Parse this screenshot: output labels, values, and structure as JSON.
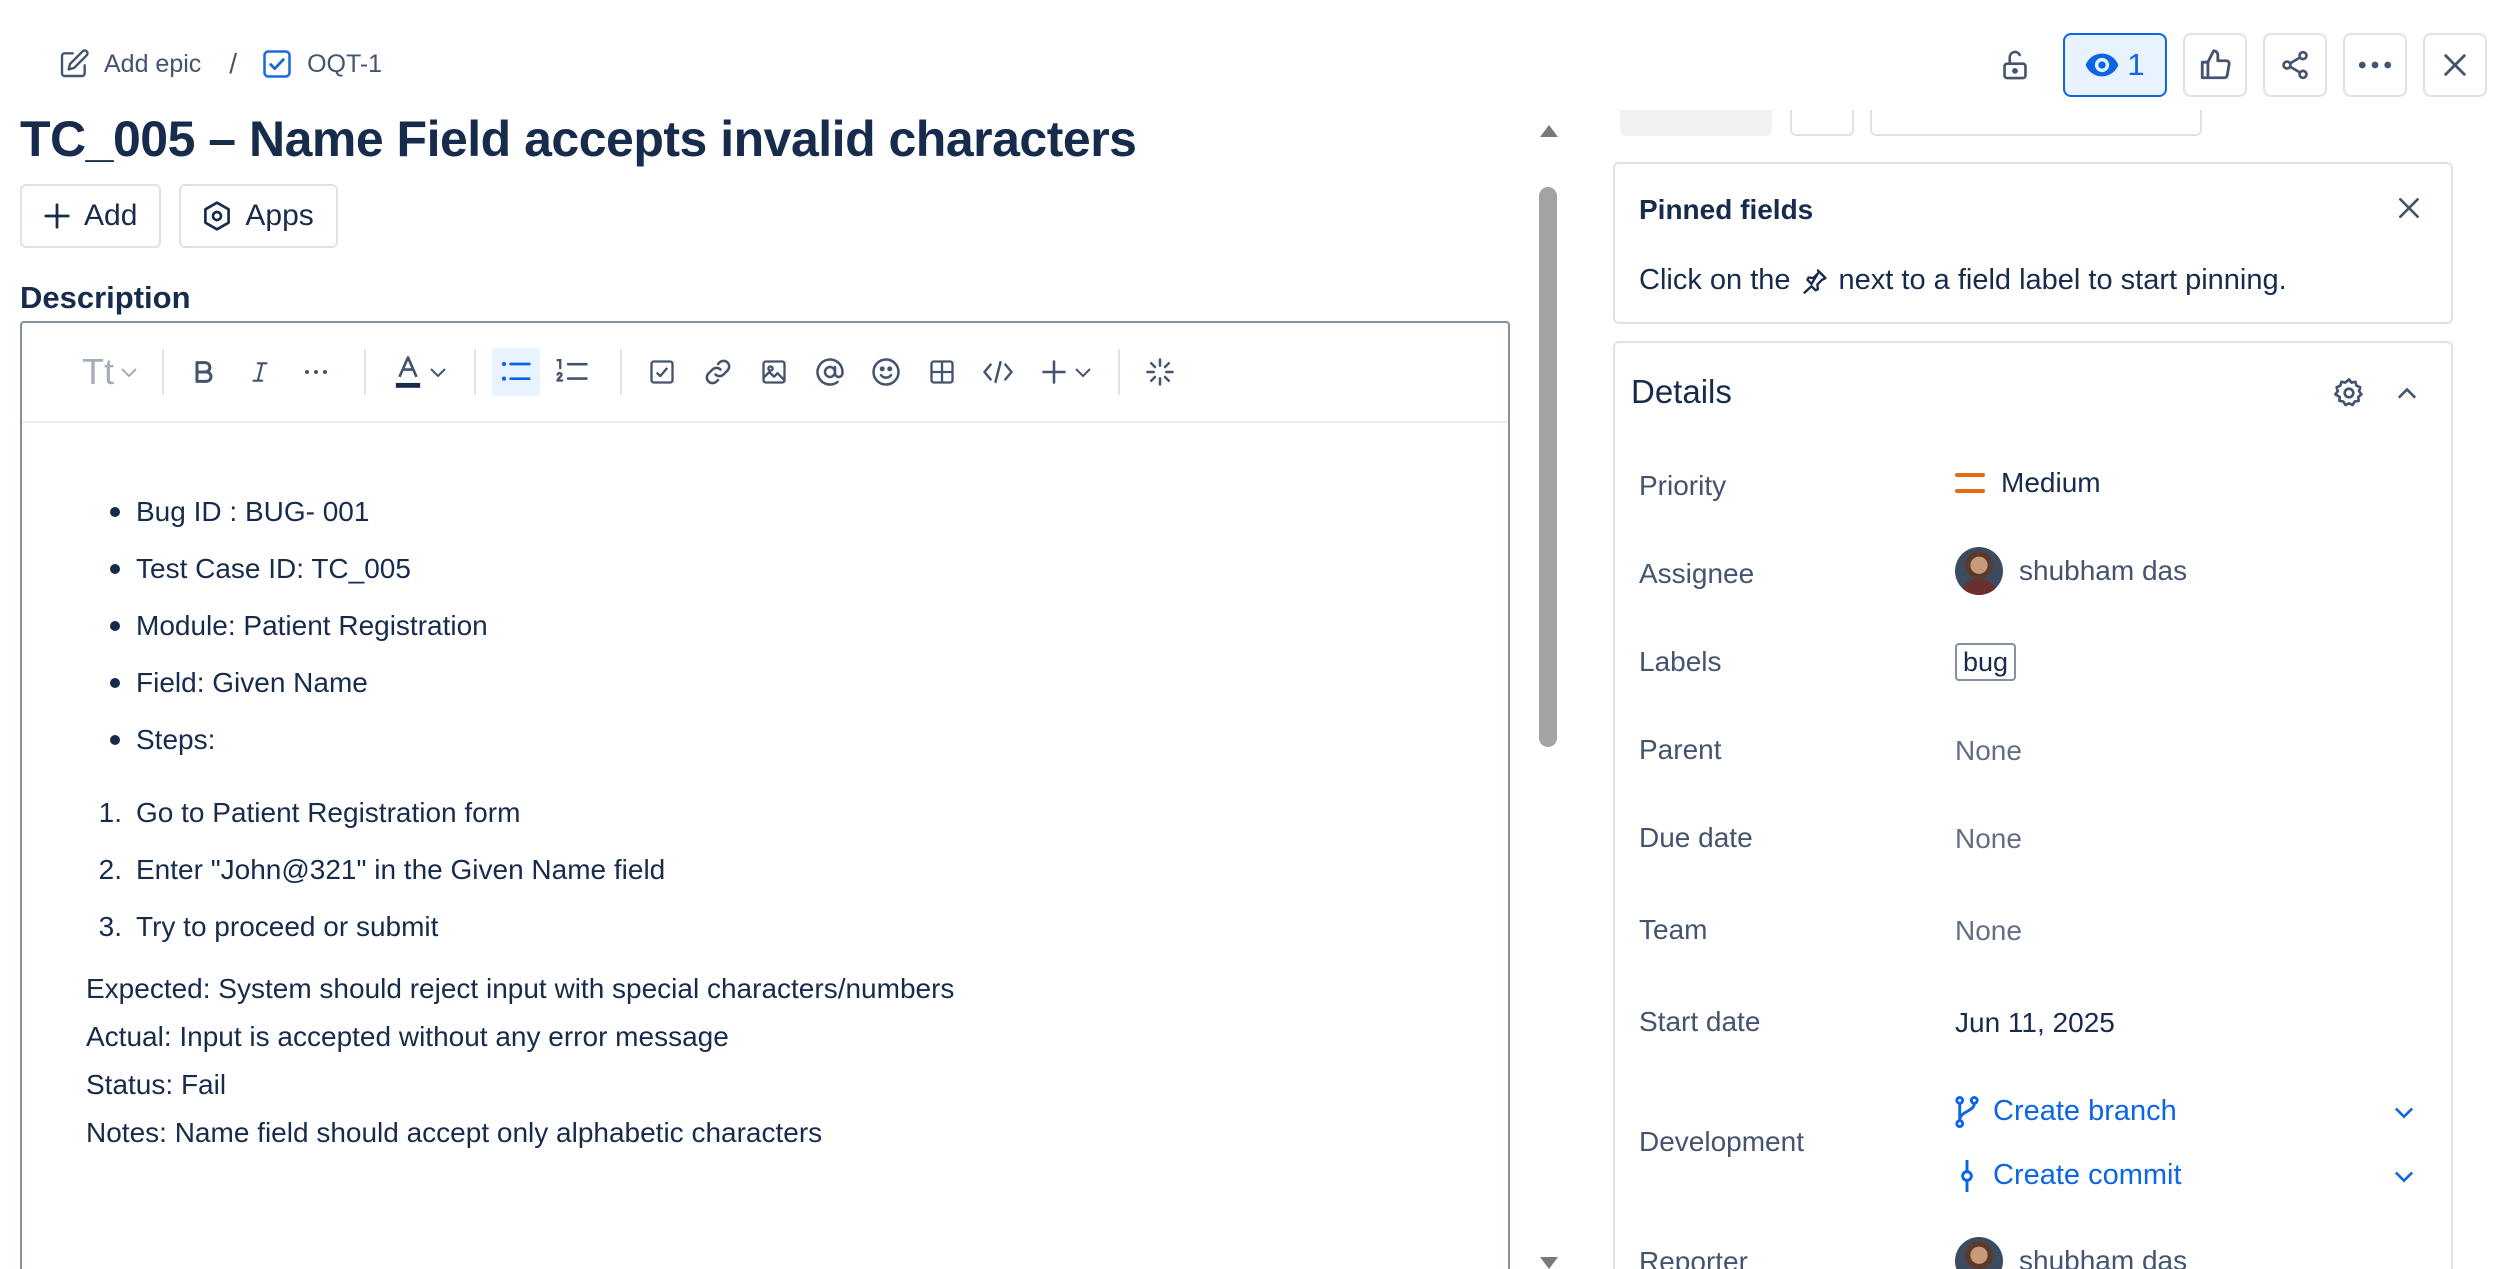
{
  "breadcrumb": {
    "epic_label": "Add epic",
    "separator": "/",
    "issue_key": "OQT-1"
  },
  "header_actions": {
    "watch_count": "1"
  },
  "issue": {
    "title": "TC_005 – Name Field accepts invalid characters",
    "add_label": "Add",
    "apps_label": "Apps",
    "description_label": "Description"
  },
  "editor": {
    "text_style_placeholder": "Tt",
    "bullets": [
      "Bug ID : BUG- 001",
      "Test Case ID: TC_005",
      "Module: Patient Registration",
      "Field: Given Name",
      "Steps:"
    ],
    "steps": [
      {
        "num": "1.",
        "text": "Go to Patient Registration form"
      },
      {
        "num": "2.",
        "text": "Enter \"John@321\" in the Given Name field"
      },
      {
        "num": "3.",
        "text": "Try to proceed or submit"
      }
    ],
    "lines": [
      "Expected: System should reject input with special characters/numbers",
      "Actual: Input is accepted without any error message",
      "Status: Fail",
      "Notes: Name field should accept only alphabetic characters"
    ]
  },
  "pinned": {
    "title": "Pinned fields",
    "hint_before": "Click on the",
    "hint_after": "next to a field label to start pinning."
  },
  "details": {
    "title": "Details",
    "priority_label": "Priority",
    "priority_value": "Medium",
    "priority_color": "#e56910",
    "assignee_label": "Assignee",
    "assignee_value": "shubham das",
    "labels_label": "Labels",
    "labels_value": "bug",
    "parent_label": "Parent",
    "parent_value": "None",
    "due_label": "Due date",
    "due_value": "None",
    "team_label": "Team",
    "team_value": "None",
    "start_label": "Start date",
    "start_value": "Jun 11, 2025",
    "development_label": "Development",
    "create_branch": "Create branch",
    "create_commit": "Create commit",
    "reporter_label": "Reporter",
    "reporter_value": "shubham das"
  },
  "colors": {
    "accent": "#0c66e4",
    "text": "#172b4d",
    "subtle": "#44546f",
    "border": "#dfe1e6"
  }
}
